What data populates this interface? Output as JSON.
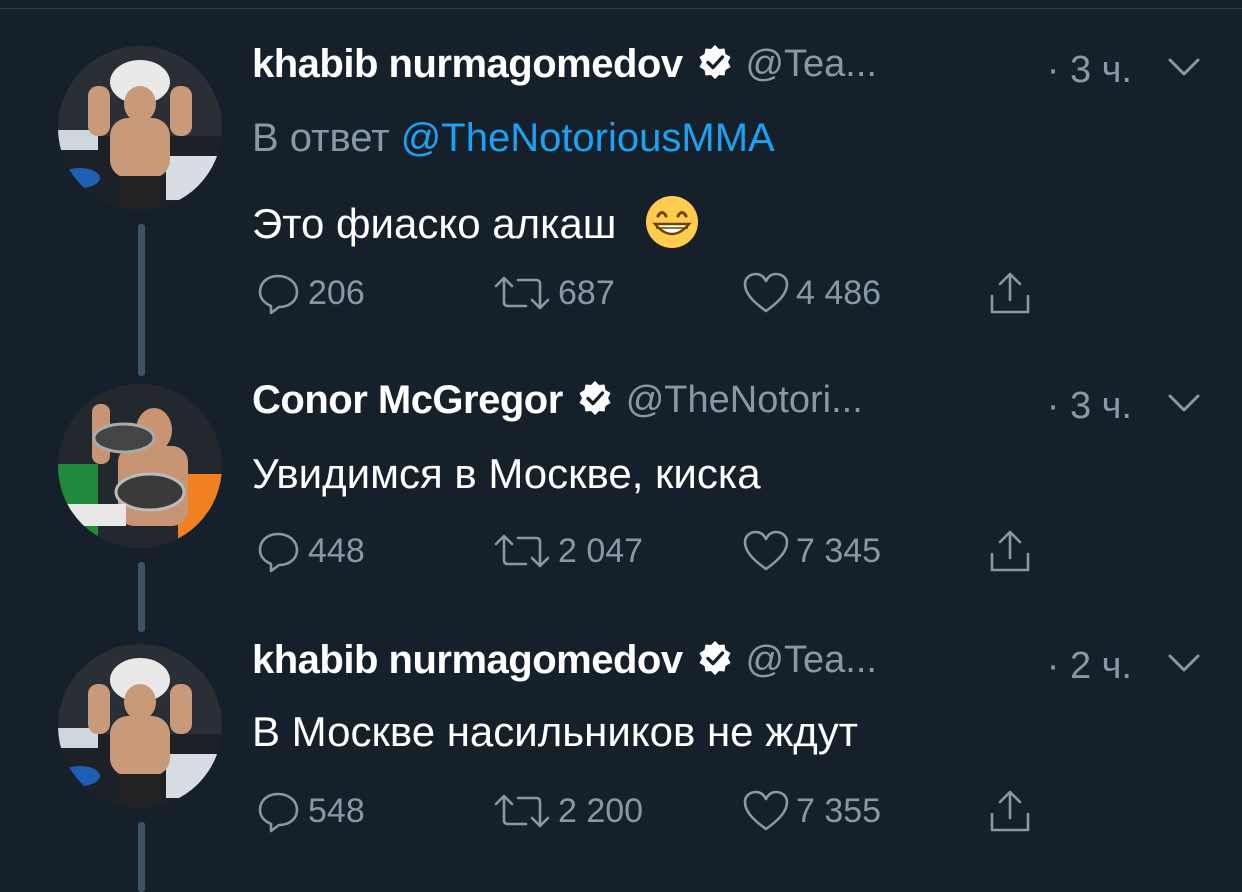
{
  "tweets": [
    {
      "name": "khabib nurmagomedov",
      "handle": "@Tea...",
      "time": "· 3 ч.",
      "reply_prefix": "В ответ",
      "reply_mention": "@TheNotoriousMMA",
      "text": "Это фиаско алкаш",
      "emoji": "grinning-face",
      "replies": "206",
      "retweets": "687",
      "likes": "4 486"
    },
    {
      "name": "Conor McGregor",
      "handle": "@TheNotori...",
      "time": "· 3 ч.",
      "text": "Увидимся в Москве, киска",
      "replies": "448",
      "retweets": "2 047",
      "likes": "7 345"
    },
    {
      "name": "khabib nurmagomedov",
      "handle": "@Tea...",
      "time": "· 2 ч.",
      "text": "В Москве насильников не ждут",
      "replies": "548",
      "retweets": "2 200",
      "likes": "7 355"
    }
  ],
  "colors": {
    "background": "#15202b",
    "secondary_text": "#8899a6",
    "mention": "#1da1f2",
    "thread_line": "#3d5466"
  }
}
